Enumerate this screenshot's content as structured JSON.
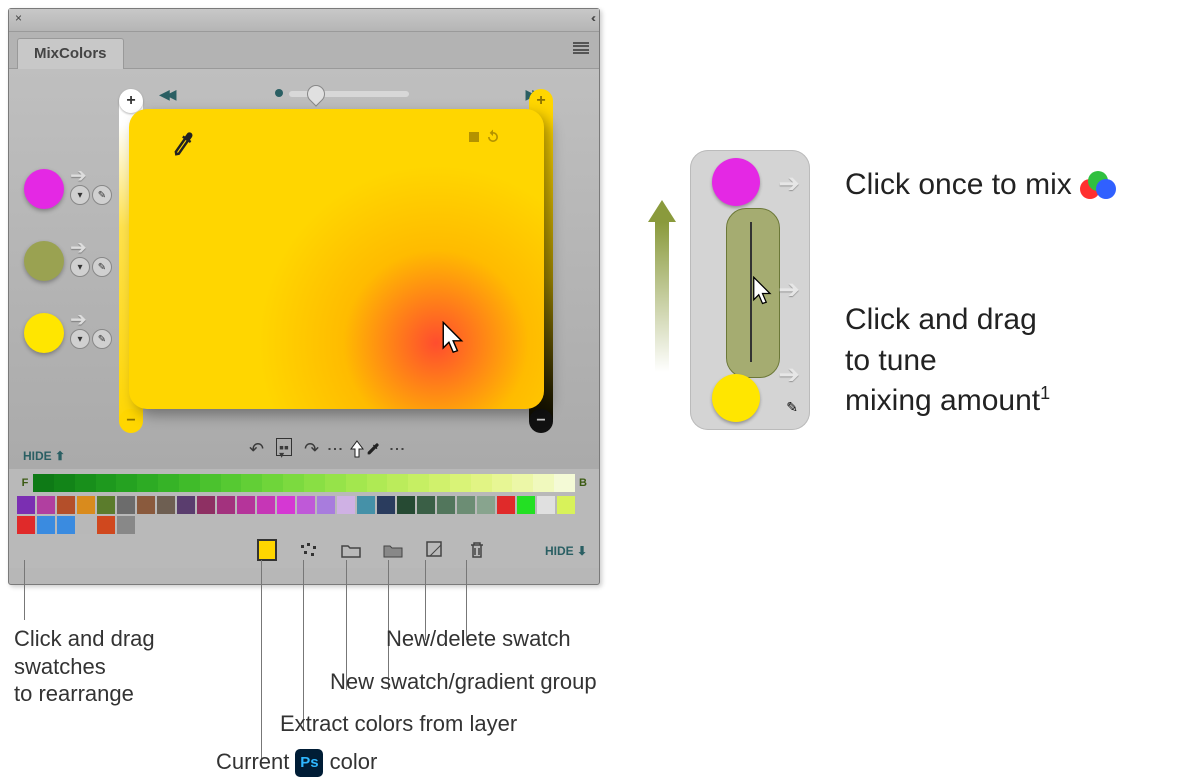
{
  "panel": {
    "title": "MixColors",
    "close_glyph": "×",
    "collapse_glyph": "‹‹",
    "hide_top": "HIDE ⬆",
    "hide_bottom": "HIDE ⬇"
  },
  "mix_swatches": [
    {
      "color": "#e428e4"
    },
    {
      "color": "#9aa251"
    },
    {
      "color": "#ffe600"
    }
  ],
  "canvas": {
    "base_color": "#ffd600",
    "spot_color": "#ff4d2e"
  },
  "current_color": "#ffd600",
  "gradient_row": {
    "front_label": "F",
    "back_label": "B",
    "stops": [
      "#0e7a16",
      "#128418",
      "#188f1b",
      "#1e991e",
      "#25a221",
      "#2dab24",
      "#36b327",
      "#40bb2a",
      "#4bc22e",
      "#56c932",
      "#62cf36",
      "#6fd53a",
      "#7cda3f",
      "#89df44",
      "#96e349",
      "#a3e74e",
      "#afea54",
      "#bbec5b",
      "#c6ef63",
      "#d0f16c",
      "#d9f377",
      "#e1f484",
      "#e7f694",
      "#ecf7a7",
      "#f0f9bd",
      "#f4fad6"
    ]
  },
  "swatch_rows": [
    [
      "#7b2fb2",
      "#b13fa0",
      "#b44f2a",
      "#d98b1d",
      "#5b7c2c",
      "#6c6c6c",
      "#8a5a3d",
      "#6e5f52",
      "#5a3d6e",
      "#8e3063",
      "#a3327e",
      "#b5349a",
      "#c636b6",
      "#d538d3",
      "#bf59d8",
      "#a87cdd",
      "#cfb1e4",
      "#4591a8",
      "#2a3c5e",
      "#264a33",
      "#3a5f46",
      "#52765c",
      "#6c8d74",
      "#88a48e",
      "#e02a2a",
      "#23e023",
      "#e0e0e0"
    ],
    [
      "#d8f25a",
      "#e02a2a",
      "#3a8be0",
      "#3a8be0",
      "#b8b8b8",
      "#d0481e",
      "#888888"
    ]
  ],
  "annotations": {
    "rearrange": "Click and drag\nswatches\nto rearrange",
    "current_color_pre": "Current ",
    "current_color_post": " color",
    "extract": "Extract colors from layer",
    "new_group": "New swatch/gradient group",
    "new_delete": "New/delete swatch"
  },
  "right": {
    "mix_once": "Click once to mix ",
    "drag": "Click and drag\nto tune\nmixing amount",
    "footnote": "1",
    "swatches": {
      "top": "#e428e4",
      "bottom": "#ffe600"
    }
  },
  "icons": {
    "ps": "Ps"
  }
}
